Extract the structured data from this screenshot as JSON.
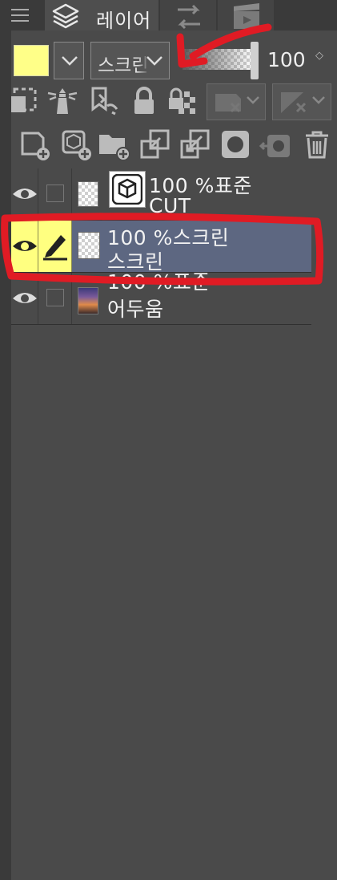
{
  "tabs": {
    "layer_label": "레이어"
  },
  "properties": {
    "color_swatch": "#ffff88",
    "blend_mode": "스크린",
    "opacity_value": "100",
    "opacity_spinner": "◇"
  },
  "layers": [
    {
      "opacity": "100 %",
      "blend": "표준",
      "name": "CUT",
      "type": "3D"
    },
    {
      "opacity": "100 %",
      "blend": "스크린",
      "name": "스크린",
      "type": "raster",
      "selected": true
    },
    {
      "opacity": "100 %",
      "blend": "표준",
      "name": "어두움",
      "type": "image"
    }
  ],
  "colors": {
    "panel_bg": "#4a4a4a",
    "selected_row": "#5d6781",
    "highlight_yellow": "#ffff80",
    "annotation_red": "#e01b24"
  }
}
